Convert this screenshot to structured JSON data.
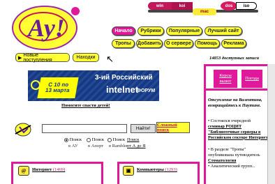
{
  "logo": {
    "text": "Ау!"
  },
  "encodings": [
    "win",
    "koi",
    "mac",
    "dos",
    "iso"
  ],
  "nav": {
    "row1": [
      "Начало",
      "Рубрики",
      "Популярные",
      "Лучший сайт"
    ],
    "row2": [
      "Тропы",
      "Добавить",
      "О сервере",
      "Помощь",
      "Реклама"
    ]
  },
  "entries_count": "14853 доступных записи",
  "sections": {
    "new": "Новые поступления",
    "finds": "Находки"
  },
  "banner": {
    "dates_line1": "С 10 по",
    "dates_line2": "13 марта",
    "title": "3-ий Российский",
    "brand": "intelnet",
    "forum": "ФОРУМ"
  },
  "help_link": "Помогите спасти детей!",
  "search": {
    "value": "",
    "button": "Найти!",
    "complex": "Сложный поиск",
    "options": [
      {
        "label": "Поиск",
        "sub": "в АУ",
        "checked": true
      },
      {
        "label": "Поиск",
        "sub": "в Апорт",
        "checked": false
      },
      {
        "label": "Поиск",
        "sub": "в Rambler",
        "checked": false
      }
    ],
    "atoz_line1": "Поиск",
    "atoz_line2": "от А до Я"
  },
  "categories": [
    {
      "label": "Интернет",
      "count": "(1469)"
    },
    {
      "label": "Компьютеры",
      "count": "(1293)"
    }
  ],
  "right": {
    "btn1": "Курсы валют",
    "btn2": "Погода",
    "italic1": "Отсупление на Валентина,",
    "italic2": "возвращайтесь к Паутине.",
    "items": [
      "• Состоялся очередной",
      "семинар РОЦИТ",
      "\"Библиотечные серверы в Российском секторе Интернета\"",
      "• В разделе \"Тропы\"",
      "опубликована путеводитель",
      "Стоматология",
      "• Аналитический групп..."
    ]
  }
}
